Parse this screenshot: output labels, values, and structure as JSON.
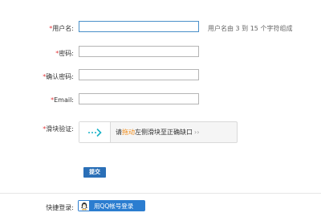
{
  "form": {
    "required_mark": "*",
    "username": {
      "label": "用户名:",
      "value": "",
      "hint": "用户名由 3 到 15 个字符组成"
    },
    "password": {
      "label": "密码:",
      "value": ""
    },
    "confirm_password": {
      "label": "确认密码:",
      "value": ""
    },
    "email": {
      "label": "Email:",
      "value": ""
    },
    "captcha": {
      "label": "滑块验证:",
      "text_before": "请",
      "text_emphasis": "拖动",
      "text_after": "左侧滑块至正确缺口",
      "arrows": "››",
      "handle_icon": "dotted-arrow-right-icon",
      "accent_color": "#1ab3c8",
      "emphasis_color": "#f08c1a"
    },
    "submit_label": "提交"
  },
  "quick_login": {
    "label": "快捷登录:",
    "qq_button_label": "用QQ帐号登录",
    "qq_icon": "qq-penguin-icon",
    "button_color": "#2b7dd0"
  },
  "colors": {
    "required": "#e4393c",
    "submit": "#2a6fb7",
    "focus_border": "#4a90c9"
  }
}
